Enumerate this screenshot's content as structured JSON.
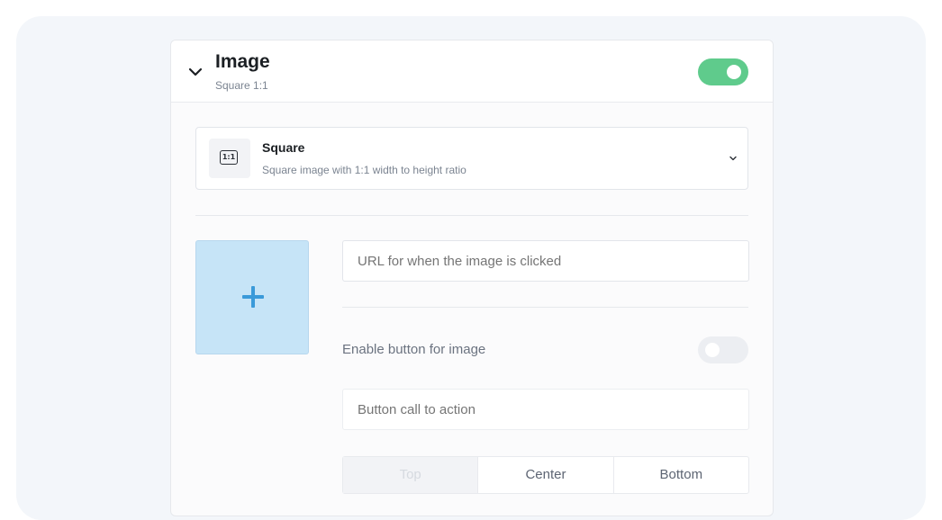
{
  "panel": {
    "title": "Image",
    "subtitle": "Square 1:1",
    "enabled": true
  },
  "ratio_select": {
    "icon_label": "1:1",
    "title": "Square",
    "description": "Square image with 1:1 width to height ratio"
  },
  "url_field": {
    "placeholder": "URL for when the image is clicked",
    "value": ""
  },
  "enable_button": {
    "label": "Enable button for image",
    "enabled": false
  },
  "cta_field": {
    "placeholder": "Button call to action",
    "value": ""
  },
  "position_options": [
    "Top",
    "Center",
    "Bottom"
  ],
  "colors": {
    "toggle_on": "#5fcb8c",
    "toggle_off": "#eceef2",
    "upload_bg": "#c6e4f7",
    "plus": "#3a9ad9"
  }
}
